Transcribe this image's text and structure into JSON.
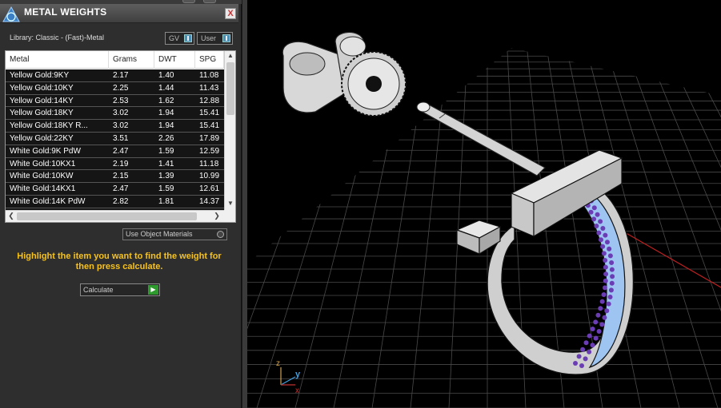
{
  "panel": {
    "title": "METAL WEIGHTS",
    "close_label": "X",
    "library_label": "Library: Classic - (Fast)-Metal",
    "toggle_gv": "GV",
    "toggle_user": "User",
    "columns": [
      "Metal",
      "Grams",
      "DWT",
      "SPG"
    ],
    "rows": [
      [
        "Yellow Gold:9KY",
        "2.17",
        "1.40",
        "11.08"
      ],
      [
        "Yellow Gold:10KY",
        "2.25",
        "1.44",
        "11.43"
      ],
      [
        "Yellow Gold:14KY",
        "2.53",
        "1.62",
        "12.88"
      ],
      [
        "Yellow Gold:18KY",
        "3.02",
        "1.94",
        "15.41"
      ],
      [
        "Yellow Gold:18KY R...",
        "3.02",
        "1.94",
        "15.41"
      ],
      [
        "Yellow Gold:22KY",
        "3.51",
        "2.26",
        "17.89"
      ],
      [
        "White Gold:9K PdW",
        "2.47",
        "1.59",
        "12.59"
      ],
      [
        "White Gold:10KX1",
        "2.19",
        "1.41",
        "11.18"
      ],
      [
        "White Gold:10KW",
        "2.15",
        "1.39",
        "10.99"
      ],
      [
        "White Gold:14KX1",
        "2.47",
        "1.59",
        "12.61"
      ],
      [
        "White Gold:14K PdW",
        "2.82",
        "1.81",
        "14.37"
      ]
    ],
    "use_object_materials": "Use Object Materials",
    "instructions": "Highlight the item you want to find the weight for then press calculate.",
    "calculate_label": "Calculate"
  },
  "viewport": {
    "axis_z": "z",
    "axis_y": "y",
    "axis_x": "x"
  },
  "colors": {
    "instruction_text": "#f7c21b",
    "go_button": "#2e9a2e",
    "grid": "#4a4a4a",
    "stones": "#6a3db5"
  }
}
